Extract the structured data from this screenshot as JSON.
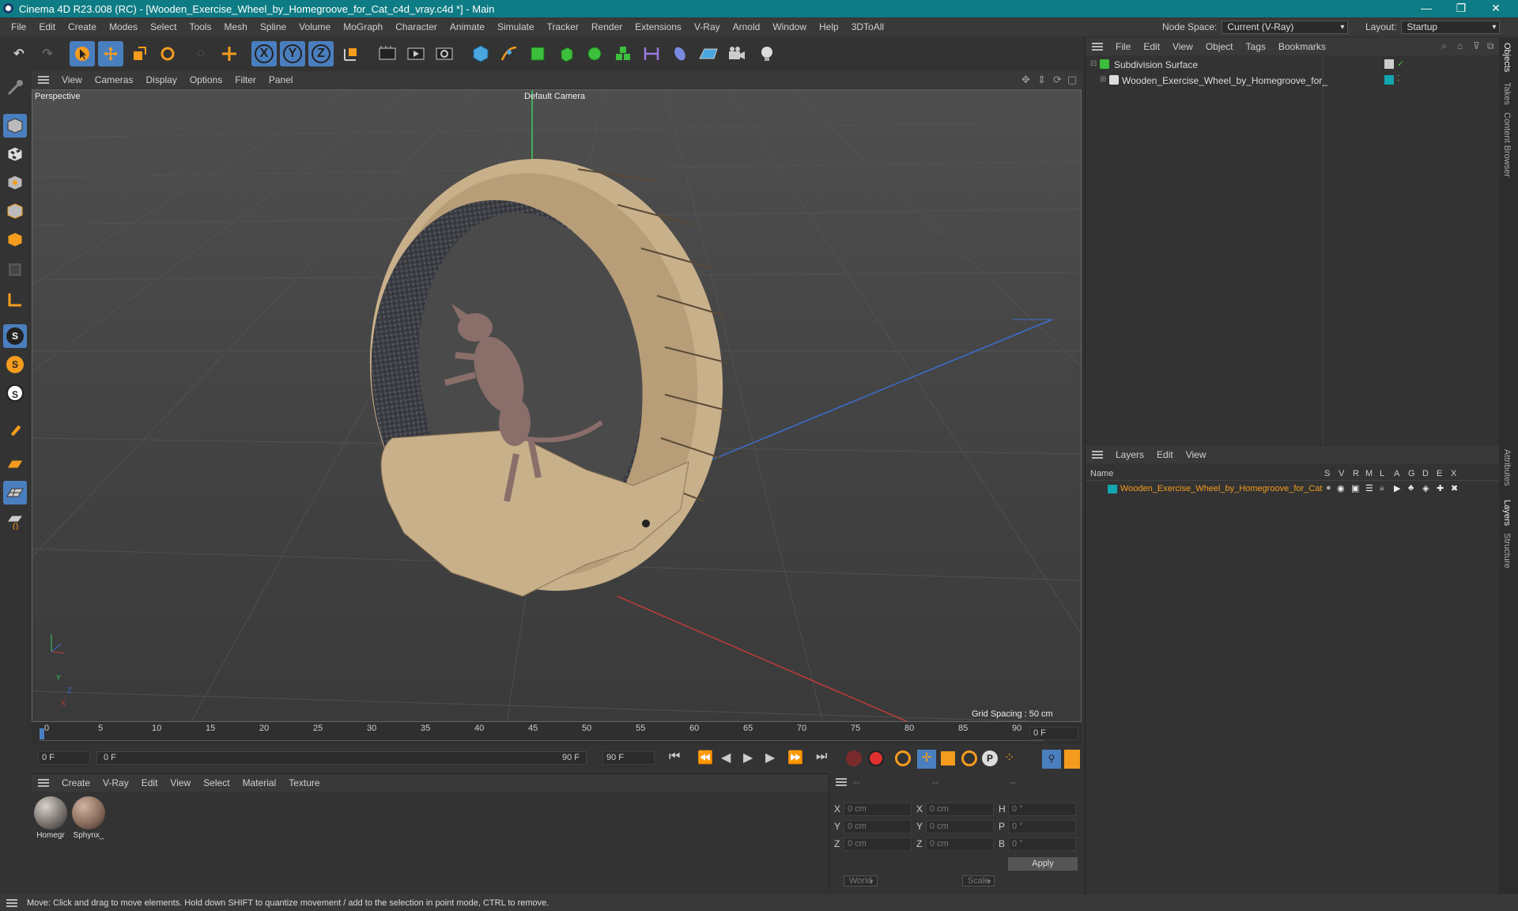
{
  "window": {
    "title": "Cinema 4D R23.008 (RC) - [Wooden_Exercise_Wheel_by_Homegroove_for_Cat_c4d_vray.c4d *] - Main",
    "minimize": "—",
    "restore": "❐",
    "close": "✕"
  },
  "menu": {
    "items": [
      "File",
      "Edit",
      "Create",
      "Modes",
      "Select",
      "Tools",
      "Mesh",
      "Spline",
      "Volume",
      "MoGraph",
      "Character",
      "Animate",
      "Simulate",
      "Tracker",
      "Render",
      "Extensions",
      "V-Ray",
      "Arnold",
      "Window",
      "Help",
      "3DToAll"
    ],
    "node_space_label": "Node Space:",
    "node_space_value": "Current (V-Ray)",
    "layout_label": "Layout:",
    "layout_value": "Startup"
  },
  "toolbar": {
    "axis_x": "X",
    "axis_y": "Y",
    "axis_z": "Z"
  },
  "leftbar": {
    "snap_s": "S"
  },
  "viewport_menu": {
    "items": [
      "View",
      "Cameras",
      "Display",
      "Options",
      "Filter",
      "Panel"
    ],
    "label": "Perspective",
    "camera": "Default Camera",
    "grid_spacing": "Grid Spacing : 50 cm",
    "axis_y": "Y",
    "axis_x": "X",
    "axis_z": "Z"
  },
  "timeline": {
    "ticks": [
      "0",
      "5",
      "10",
      "15",
      "20",
      "25",
      "30",
      "35",
      "40",
      "45",
      "50",
      "55",
      "60",
      "65",
      "70",
      "75",
      "80",
      "85",
      "90"
    ],
    "current_frame": "0 F"
  },
  "transport": {
    "start_frame": "0 F",
    "range_start": "0 F",
    "range_end": "90 F",
    "end_frame": "90 F"
  },
  "materials": {
    "menu": [
      "Create",
      "V-Ray",
      "Edit",
      "View",
      "Select",
      "Material",
      "Texture"
    ],
    "items": [
      {
        "name": "Homegr",
        "color": "#7a7470"
      },
      {
        "name": "Sphynx_",
        "color": "#8a6e5e"
      }
    ]
  },
  "coords": {
    "header_dashes": [
      "--",
      "--",
      "--"
    ],
    "rows": [
      {
        "a": "X",
        "av": "0 cm",
        "b": "X",
        "bv": "0 cm",
        "c": "H",
        "cv": "0 °"
      },
      {
        "a": "Y",
        "av": "0 cm",
        "b": "Y",
        "bv": "0 cm",
        "c": "P",
        "cv": "0 °"
      },
      {
        "a": "Z",
        "av": "0 cm",
        "b": "Z",
        "bv": "0 cm",
        "c": "B",
        "cv": "0 °"
      }
    ],
    "world": "World",
    "scale": "Scale",
    "apply": "Apply"
  },
  "objects": {
    "menu": [
      "File",
      "Edit",
      "View",
      "Object",
      "Tags",
      "Bookmarks"
    ],
    "items": [
      {
        "name": "Subdivision Surface"
      },
      {
        "name": "Wooden_Exercise_Wheel_by_Homegroove_for_Cat"
      }
    ]
  },
  "layers": {
    "menu": [
      "Layers",
      "Edit",
      "View"
    ],
    "header_name": "Name",
    "header_cols": [
      "S",
      "V",
      "R",
      "M",
      "L",
      "A",
      "G",
      "D",
      "E",
      "X"
    ],
    "row_name": "Wooden_Exercise_Wheel_by_Homegroove_for_Cat",
    "color": "#13a5b0"
  },
  "right_tabs": [
    "Objects",
    "Takes",
    "Content Browser",
    "Attributes",
    "Layers",
    "Structure"
  ],
  "status": "Move: Click and drag to move elements. Hold down SHIFT to quantize movement / add to the selection in point mode, CTRL to remove.",
  "colors": {
    "accent": "#0e7c84",
    "orange": "#f39c1e",
    "highlight": "#4a7fbf"
  }
}
